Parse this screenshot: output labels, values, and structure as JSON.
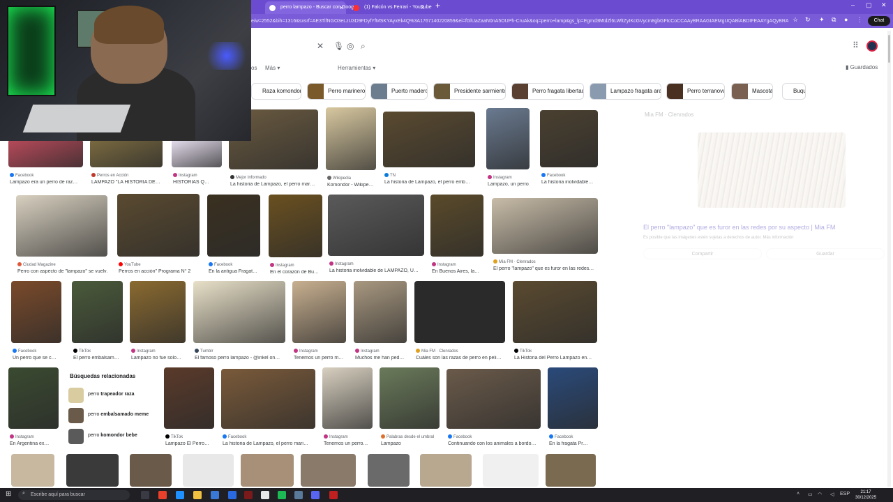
{
  "browser": {
    "tabs": [
      {
        "label": "perro lampazo - Buscar con Goog…",
        "active": true,
        "icon_color": "#ffffff"
      },
      {
        "label": "(1) Falcón vs Ferrari - YouTube",
        "active": false,
        "icon_color": "#ff3030"
      }
    ],
    "url": "e/w=2552&bih=1316&sxsrf=AE3TifNGO3eLzU3D9FDyfYfMSKYAyxEk4Q%3A1767140220859&ei=fGlUaZaaN0nA5OUPh-CruAk&oq=perro+lamp&gs_lp=Egmd3MtdZl6LWltZyIKcGVycm8gbGFtcCoCCAAyBRAAGIAEMgUQABiABDIFEAAYgAQyBRAAGAE…",
    "chat_label": "Chat"
  },
  "search": {
    "filters": [
      "os",
      "Más",
      "Herramientas"
    ],
    "saved_label": "Guardados"
  },
  "chips": [
    {
      "label": "Raza komondor",
      "color": "#ffffff"
    },
    {
      "label": "Perro marinero",
      "color": "#7a5a2a"
    },
    {
      "label": "Puerto madero",
      "color": "#6b7d8e"
    },
    {
      "label": "Presidente sarmiento",
      "color": "#6b5a3a"
    },
    {
      "label": "Perro fragata libertad",
      "color": "#5a4030"
    },
    {
      "label": "Lampazo fragata ara",
      "color": "#8a9bb0"
    },
    {
      "label": "Perro terranova",
      "color": "#4a3020"
    },
    {
      "label": "Mascota",
      "color": "#7a6050"
    },
    {
      "label": "Buque",
      "color": "#ffffff"
    }
  ],
  "results": [
    {
      "src": "Facebook",
      "title": "Lampazo era un perro de raz…",
      "color": "#b84a5a",
      "dot": "#1877f2"
    },
    {
      "src": "Perros en Acción",
      "title": "LAMPAZO \"LA HISTORIA DE…",
      "color": "#7a6a40",
      "dot": "#c0392b"
    },
    {
      "src": "Instagram",
      "title": "HISTORIAS Q…",
      "color": "#e8e0f0",
      "dot": "#c13584"
    },
    {
      "src": "Mejor Informado",
      "title": "La historia de Lampazo, el perro mar…",
      "color": "#6a5a40",
      "dot": "#333333"
    },
    {
      "src": "Wikipedia",
      "title": "Komondor - Wikipe…",
      "color": "#d8c8a0",
      "dot": "#666666"
    },
    {
      "src": "TN",
      "title": "La historia de Lampazo, el perro emb…",
      "color": "#5a4a30",
      "dot": "#0a7bd8"
    },
    {
      "src": "Instagram",
      "title": "Lampazo, un perro…",
      "color": "#6a7a90",
      "dot": "#c13584"
    },
    {
      "src": "Facebook",
      "title": "La historia inolvidable…",
      "color": "#4a4030",
      "dot": "#1877f2"
    },
    {
      "src": "Ciudad Magazine",
      "title": "Perro con aspecto de \"lampazo\" se vuelv…",
      "color": "#d8d0c0",
      "dot": "#e05a3a"
    },
    {
      "src": "YouTube",
      "title": "Perros en acción\" Programa N° 2",
      "color": "#5a4a30",
      "dot": "#ff0000"
    },
    {
      "src": "Facebook",
      "title": "En la antigua Fragat…",
      "color": "#3a3020",
      "dot": "#1877f2"
    },
    {
      "src": "Instagram",
      "title": "En el corazón de Bu…",
      "color": "#6a5020",
      "dot": "#c13584"
    },
    {
      "src": "Instagram",
      "title": "La historia inolvidable de LAMPAZO, U…",
      "color": "#5a5a5a",
      "dot": "#c13584"
    },
    {
      "src": "Instagram",
      "title": "En Buenos Aires, la…",
      "color": "#5a4a2a",
      "dot": "#c13584"
    },
    {
      "src": "Mia FM · Clenrados",
      "title": "El perro \"lampazo\" que es furor en las redes…",
      "color": "#c8bca8",
      "dot": "#e0a020"
    },
    {
      "src": "Facebook",
      "title": "Un perro que se c…",
      "color": "#7a4a2a",
      "dot": "#1877f2"
    },
    {
      "src": "TikTok",
      "title": "El perro embalsam…",
      "color": "#4a5a3a",
      "dot": "#000000"
    },
    {
      "src": "Instagram",
      "title": "Lampazo no fue solo…",
      "color": "#8a6a30",
      "dot": "#c13584"
    },
    {
      "src": "Tumblr",
      "title": "El famoso perro lampazo - @inkel on…",
      "color": "#e8e0c8",
      "dot": "#35465c"
    },
    {
      "src": "Instagram",
      "title": "Tenemos un perro m…",
      "color": "#c8b090",
      "dot": "#c13584"
    },
    {
      "src": "Instagram",
      "title": "Muchos me han ped…",
      "color": "#a89880",
      "dot": "#c13584"
    },
    {
      "src": "Mia FM · Clenrados",
      "title": "Cuáles son las razas de perro en peli…",
      "color": "#2a2a2a",
      "dot": "#e0a020"
    },
    {
      "src": "TikTok",
      "title": "La Historia del Perro Lampazo en…",
      "color": "#5a4a30",
      "dot": "#000000"
    },
    {
      "src": "Instagram",
      "title": "En Argentina ex…",
      "color": "#3a4a30",
      "dot": "#c13584"
    },
    {
      "src": "TikTok",
      "title": "Lampazo El Perro…",
      "color": "#5a3a2a",
      "dot": "#000000"
    },
    {
      "src": "Facebook",
      "title": "La historia de Lampazo, el perro mari…",
      "color": "#7a5a3a",
      "dot": "#1877f2"
    },
    {
      "src": "Instagram",
      "title": "Tenemos un perro…",
      "color": "#d8d0c0",
      "dot": "#c13584"
    },
    {
      "src": "Palabras desde el umbral",
      "title": "Lampazo",
      "color": "#6a7a5a",
      "dot": "#e07030"
    },
    {
      "src": "Facebook",
      "title": "Continuando con los animales a bordo…",
      "color": "#6a5a4a",
      "dot": "#1877f2"
    },
    {
      "src": "Facebook",
      "title": "En la fragata Pr…",
      "color": "#2a4a7a",
      "dot": "#1877f2"
    }
  ],
  "related": {
    "heading": "Búsquedas relacionadas",
    "items": [
      {
        "pre": "perro ",
        "bold": "trapeador raza",
        "color": "#d8cca0"
      },
      {
        "pre": "perro ",
        "bold": "embalsamado meme",
        "color": "#6a5a4a"
      },
      {
        "pre": "perro ",
        "bold": "komondor bebe",
        "color": "#5a5a5a"
      }
    ]
  },
  "side_panel": {
    "source": "Mia FM · Clenrados",
    "title": "El perro \"lampazo\" que es furor en las redes por su aspecto | Mia FM",
    "note": "Es posible que las imágenes estén sujetas a derechos de autor. Más información",
    "share_label": "Compartir",
    "save_label": "Guardar"
  },
  "taskbar": {
    "search_placeholder": "Escribe aquí para buscar",
    "lang": "ESP",
    "time": "21:17",
    "date": "30/12/2025"
  }
}
